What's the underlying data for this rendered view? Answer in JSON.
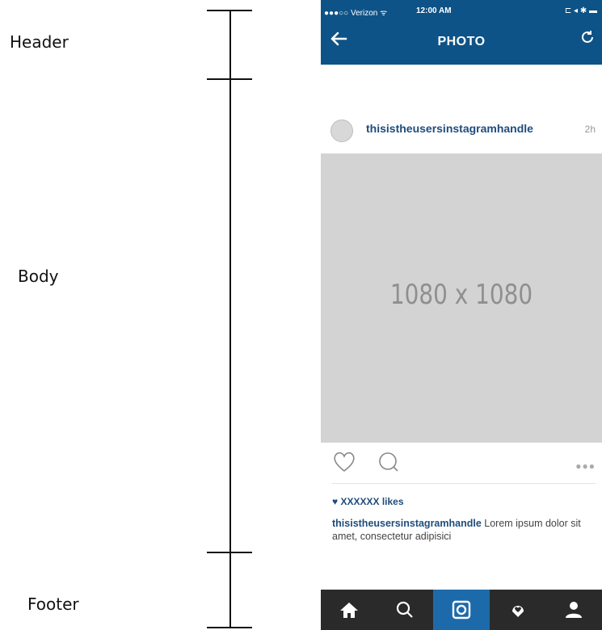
{
  "sections": {
    "header_label": "Header",
    "body_label": "Body",
    "footer_label": "Footer"
  },
  "status_bar": {
    "carrier": "●●●○○ Verizon ᯤ",
    "time": "12:00 AM",
    "battery": "⊏ ◂ ✱ ▬"
  },
  "nav": {
    "title": "PHOTO",
    "back_icon": "arrow-left",
    "refresh_icon": "refresh"
  },
  "post": {
    "avatar_label": "",
    "handle": "thisistheusersinstagramhandle",
    "time": "2h",
    "photo_dimensions": "1080 x 1080",
    "likes": "♥ XXXXXX likes",
    "caption_handle": "thisistheusersinstagramhandle",
    "caption_text": " Lorem ipsum dolor sit amet, consectetur adipisici",
    "more": "●●●"
  },
  "colors": {
    "header_bg": "#0e5387",
    "footer_bg": "#2a2a2a",
    "active_tab": "#1d6aaa",
    "placeholder": "#d3d3d3"
  },
  "tabs": [
    {
      "icon": "home-icon",
      "active": false
    },
    {
      "icon": "search-icon",
      "active": false
    },
    {
      "icon": "camera-icon",
      "active": true
    },
    {
      "icon": "activity-icon",
      "active": false
    },
    {
      "icon": "profile-icon",
      "active": false
    }
  ]
}
